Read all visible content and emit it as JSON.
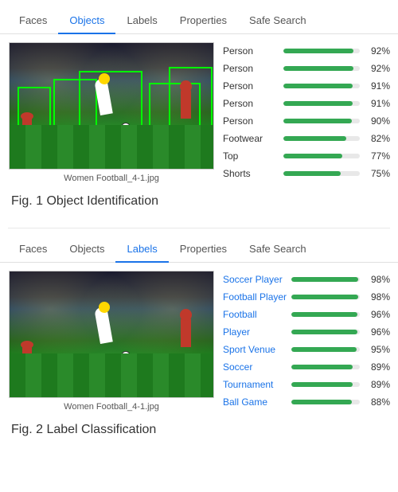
{
  "section1": {
    "tabs": [
      "Faces",
      "Objects",
      "Labels",
      "Properties",
      "Safe Search"
    ],
    "active_tab": "Objects",
    "image_filename": "Women Football_4-1.jpg",
    "fig_label": "Fig. 1  Object Identification",
    "properties": [
      {
        "label": "Person",
        "pct": 92,
        "pct_label": "92%"
      },
      {
        "label": "Person",
        "pct": 92,
        "pct_label": "92%"
      },
      {
        "label": "Person",
        "pct": 91,
        "pct_label": "91%"
      },
      {
        "label": "Person",
        "pct": 91,
        "pct_label": "91%"
      },
      {
        "label": "Person",
        "pct": 90,
        "pct_label": "90%"
      },
      {
        "label": "Footwear",
        "pct": 82,
        "pct_label": "82%"
      },
      {
        "label": "Top",
        "pct": 77,
        "pct_label": "77%"
      },
      {
        "label": "Shorts",
        "pct": 75,
        "pct_label": "75%"
      }
    ]
  },
  "section2": {
    "tabs": [
      "Faces",
      "Objects",
      "Labels",
      "Properties",
      "Safe Search"
    ],
    "active_tab": "Labels",
    "image_filename": "Women Football_4-1.jpg",
    "fig_label": "Fig. 2  Label Classification",
    "properties": [
      {
        "label": "Soccer Player",
        "pct": 98,
        "pct_label": "98%"
      },
      {
        "label": "Football Player",
        "pct": 98,
        "pct_label": "98%"
      },
      {
        "label": "Football",
        "pct": 96,
        "pct_label": "96%"
      },
      {
        "label": "Player",
        "pct": 96,
        "pct_label": "96%"
      },
      {
        "label": "Sport Venue",
        "pct": 95,
        "pct_label": "95%"
      },
      {
        "label": "Soccer",
        "pct": 89,
        "pct_label": "89%"
      },
      {
        "label": "Tournament",
        "pct": 89,
        "pct_label": "89%"
      },
      {
        "label": "Ball Game",
        "pct": 88,
        "pct_label": "88%"
      }
    ]
  }
}
